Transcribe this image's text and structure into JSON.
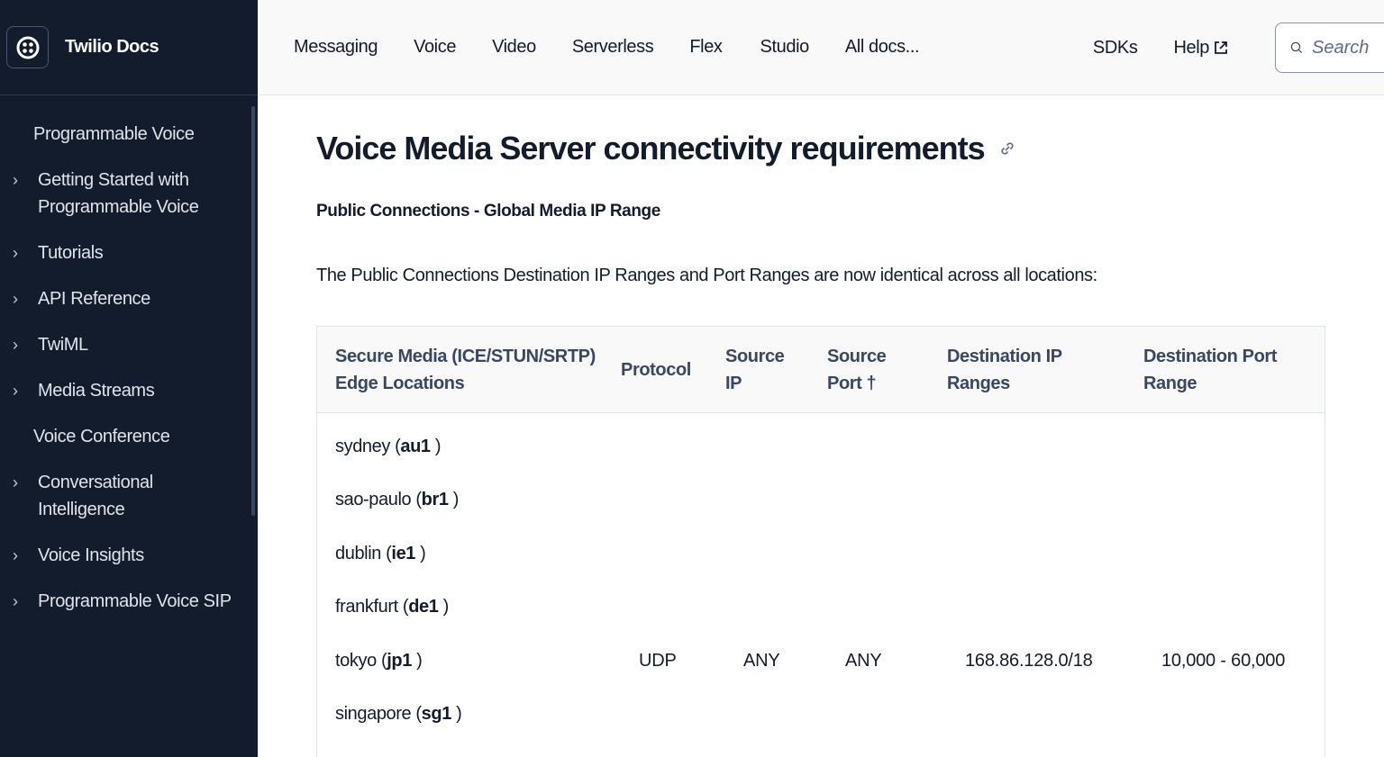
{
  "brand": {
    "title": "Twilio Docs",
    "logo_icon": "twilio-logo-icon"
  },
  "sidebar": {
    "items": [
      {
        "label": "Programmable Voice",
        "chevron": false
      },
      {
        "label": "Getting Started with Programmable Voice",
        "chevron": true
      },
      {
        "label": "Tutorials",
        "chevron": true
      },
      {
        "label": "API Reference",
        "chevron": true
      },
      {
        "label": "TwiML",
        "chevron": true
      },
      {
        "label": "Media Streams",
        "chevron": true
      },
      {
        "label": "Voice Conference",
        "chevron": false
      },
      {
        "label": "Conversational Intelligence",
        "chevron": true
      },
      {
        "label": "Voice Insights",
        "chevron": true
      },
      {
        "label": "Programmable Voice SIP",
        "chevron": true
      }
    ]
  },
  "topnav": {
    "links": [
      "Messaging",
      "Voice",
      "Video",
      "Serverless",
      "Flex",
      "Studio",
      "All docs..."
    ],
    "sdks": "SDKs",
    "help": "Help",
    "search_placeholder": "Search"
  },
  "main": {
    "title": "Voice Media Server connectivity requirements",
    "subhead": "Public Connections - Global Media IP Range",
    "paragraph": "The Public Connections Destination IP Ranges and Port Ranges are now identical across all locations:"
  },
  "table": {
    "headers": {
      "c1a": "Secure Media (ICE/STUN/SRTP)",
      "c1b": "Edge Locations",
      "c2": "Protocol",
      "c3a": "Source",
      "c3b": "IP",
      "c4a": "Source",
      "c4b": "Port †",
      "c5a": "Destination IP",
      "c5b": "Ranges",
      "c6a": "Destination Port",
      "c6b": "Range"
    },
    "locations": [
      {
        "name": "sydney (",
        "code": "au1",
        "end": " )"
      },
      {
        "name": "sao-paulo (",
        "code": "br1",
        "end": " )"
      },
      {
        "name": "dublin (",
        "code": "ie1",
        "end": " )"
      },
      {
        "name": "frankfurt (",
        "code": "de1",
        "end": " )"
      },
      {
        "name": "tokyo (",
        "code": "jp1",
        "end": " )"
      },
      {
        "name": "singapore (",
        "code": "sg1",
        "end": " )"
      }
    ],
    "protocol": "UDP",
    "source_ip": "ANY",
    "source_port": "ANY",
    "dest_ip": "168.86.128.0/18",
    "dest_port": "10,000 - 60,000"
  }
}
